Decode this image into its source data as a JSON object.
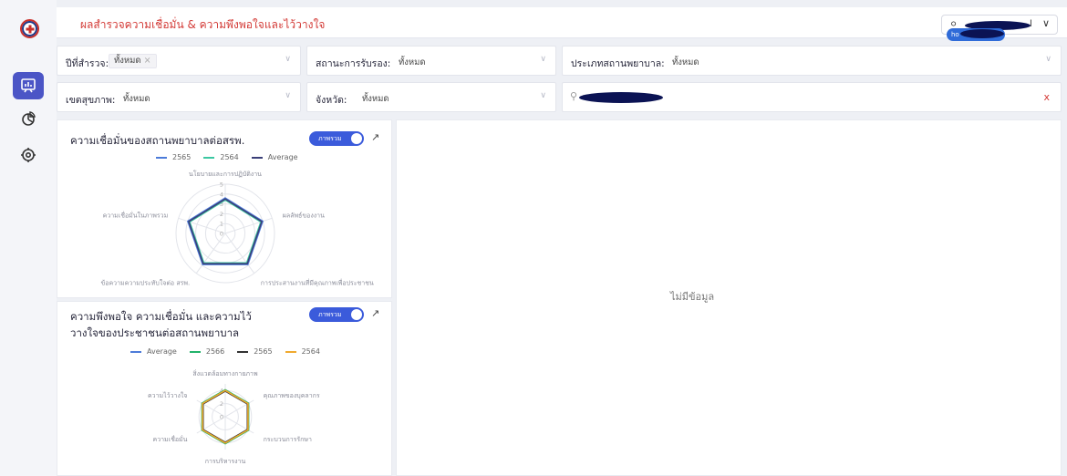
{
  "header": {
    "title": "ผลสำรวจความเชื่อมั่น & ความพึงพอใจและไว้วางใจ",
    "user_initial": "l",
    "user_tag": "ho"
  },
  "filters": {
    "year": {
      "label": "ปีที่สำรวจ:",
      "value": "ทั้งหมด"
    },
    "status": {
      "label": "สถานะการรับรอง:",
      "value": "ทั้งหมด"
    },
    "hospital_type": {
      "label": "ประเภทสถานพยาบาล:",
      "value": "ทั้งหมด"
    },
    "region": {
      "label": "เขตสุขภาพ:",
      "value": "ทั้งหมด"
    },
    "province": {
      "label": "จังหวัด:",
      "value": "ทั้งหมด"
    }
  },
  "panels": {
    "chart1": {
      "title": "ความเชื่อมั่นของสถานพยาบาลต่อสรพ.",
      "toggle_label": "ภาพรวม"
    },
    "chart2": {
      "title_line1": "ความพึงพอใจ ความเชื่อมั่น และความไว้",
      "title_line2": "วางใจของประชาชนต่อสถานพยาบาล",
      "toggle_label": "ภาพรวม"
    },
    "right": {
      "empty_text": "ไม่มีข้อมูล"
    }
  },
  "colors": {
    "accent": "#3b5bdb",
    "title_red": "#d33a36",
    "series_blue": "#4c7bd9",
    "series_teal": "#3cc7a2",
    "series_navy": "#3a3f78",
    "series_green": "#22b36a",
    "series_dark": "#333333",
    "series_orange": "#f0a92e"
  },
  "icons": [
    "logo-icon",
    "dashboard-icon",
    "pie-chart-icon",
    "target-icon",
    "user-icon",
    "chevron-down-icon",
    "search-icon",
    "close-icon",
    "external-link-icon"
  ],
  "chart_data": [
    {
      "type": "radar",
      "legend_position": "top",
      "axes": [
        "นโยบายและการปฏิบัติงาน",
        "ผลลัพธ์ของงาน",
        "การประสานงานที่มีคุณภาพเพื่อประชาชน",
        "ข้อความความประทับใจต่อ สรพ.",
        "ความเชื่อมั่นในภาพรวม"
      ],
      "ticks": [
        0,
        1,
        2,
        3,
        4,
        5
      ],
      "range": [
        0,
        5
      ],
      "series": [
        {
          "name": "2565",
          "color": "#4c7bd9",
          "values": [
            3.6,
            4.0,
            3.9,
            3.9,
            4.0
          ]
        },
        {
          "name": "2564",
          "color": "#3cc7a2",
          "values": [
            3.4,
            3.8,
            3.7,
            3.7,
            3.8
          ]
        },
        {
          "name": "Average",
          "color": "#3a3f78",
          "values": [
            3.5,
            3.9,
            3.8,
            3.8,
            3.9
          ]
        }
      ]
    },
    {
      "type": "radar",
      "legend_position": "top",
      "axes": [
        "สิ่งแวดล้อมทางกายภาพ",
        "คุณภาพของบุคลากร",
        "กระบวนการรักษา",
        "การบริหารงาน",
        "ความเชื่อมั่น",
        "ความไว้วางใจ"
      ],
      "ticks": [
        0,
        2,
        4
      ],
      "range": [
        0,
        5
      ],
      "series": [
        {
          "name": "Average",
          "color": "#4c7bd9",
          "values": [
            4.0,
            4.0,
            4.0,
            4.0,
            4.0,
            4.0
          ]
        },
        {
          "name": "2566",
          "color": "#22b36a",
          "values": [
            4.1,
            4.1,
            4.1,
            4.1,
            4.1,
            4.1
          ]
        },
        {
          "name": "2565",
          "color": "#333333",
          "values": [
            3.9,
            3.9,
            3.9,
            3.9,
            3.9,
            3.9
          ]
        },
        {
          "name": "2564",
          "color": "#f0a92e",
          "values": [
            4.0,
            4.0,
            4.0,
            4.0,
            4.0,
            4.0
          ]
        }
      ]
    }
  ]
}
